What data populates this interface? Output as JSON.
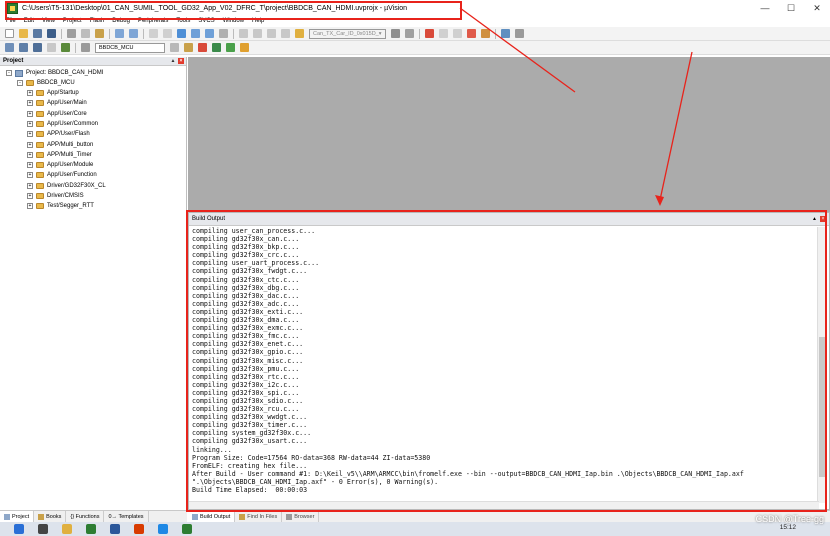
{
  "window": {
    "title": "C:\\Users\\T5-131\\Desktop\\01_CAN_SUMIL_TOOL_GD32_App_V02_DFRC_T\\project\\BBDCB_CAN_HDMI.uvprojx - µVision",
    "controls": [
      "—",
      "☐",
      "✕"
    ]
  },
  "menu": [
    "File",
    "Edit",
    "View",
    "Project",
    "Flash",
    "Debug",
    "Peripherals",
    "Tools",
    "SVCS",
    "Window",
    "Help"
  ],
  "toolbar": {
    "find_combo": "Can_TX_Car_ID_0x015D_▾",
    "target_combo": "BBDCB_MCU"
  },
  "project_panel": {
    "title": "Project",
    "root": "Project: BBDCB_CAN_HDMI",
    "target": "BBDCB_MCU",
    "groups": [
      "App/Startup",
      "App/User/Main",
      "App/User/Core",
      "App/User/Common",
      "APP/User/Flash",
      "APP/Multi_button",
      "APP/Multi_Timer",
      "App/User/Module",
      "App/User/Function",
      "Driver/GD32F30X_CL",
      "Driver/CMSIS",
      "Test/Segger_RTT"
    ],
    "tabs": [
      "Project",
      "Books",
      "{} Functions",
      "0→ Templates"
    ]
  },
  "build_output": {
    "title": "Build Output",
    "lines": [
      "compiling user_can_process.c...",
      "compiling gd32f30x_can.c...",
      "compiling gd32f30x_bkp.c...",
      "compiling gd32f30x_crc.c...",
      "compiling user_uart_process.c...",
      "compiling gd32f30x_fwdgt.c...",
      "compiling gd32f30x_ctc.c...",
      "compiling gd32f30x_dbg.c...",
      "compiling gd32f30x_dac.c...",
      "compiling gd32f30x_adc.c...",
      "compiling gd32f30x_exti.c...",
      "compiling gd32f30x_dma.c...",
      "compiling gd32f30x_exmc.c...",
      "compiling gd32f30x_fmc.c...",
      "compiling gd32f30x_enet.c...",
      "compiling gd32f30x_gpio.c...",
      "compiling gd32f30x_misc.c...",
      "compiling gd32f30x_pmu.c...",
      "compiling gd32f30x_rtc.c...",
      "compiling gd32f30x_i2c.c...",
      "compiling gd32f30x_spi.c...",
      "compiling gd32f30x_sdio.c...",
      "compiling gd32f30x_rcu.c...",
      "compiling gd32f30x_wwdgt.c...",
      "compiling gd32f30x_timer.c...",
      "compiling system_gd32f30x.c...",
      "compiling gd32f30x_usart.c...",
      "linking...",
      "Program Size: Code=17564 RO-data=368 RW-data=44 ZI-data=5380",
      "FromELF: creating hex file...",
      "After Build - User command #1: D:\\Keil_v5\\\\ARM\\ARMCC\\bin\\fromelf.exe --bin --output=BBDCB_CAN_HDMI_Iap.bin .\\Objects\\BBDCB_CAN_HDMI_Iap.axf",
      "\".\\Objects\\BBDCB_CAN_HDMI_Iap.axf\" - 0 Error(s), 0 Warning(s).",
      "Build Time Elapsed:  00:00:03"
    ],
    "tabs": [
      "Build Output",
      "Find In Files",
      "Browser"
    ]
  },
  "taskbar": {
    "time": "15:12"
  },
  "watermark": "CSDN @Tree-gg",
  "colors": {
    "highlight": "#e8231b",
    "editor_bg": "#ababab"
  }
}
